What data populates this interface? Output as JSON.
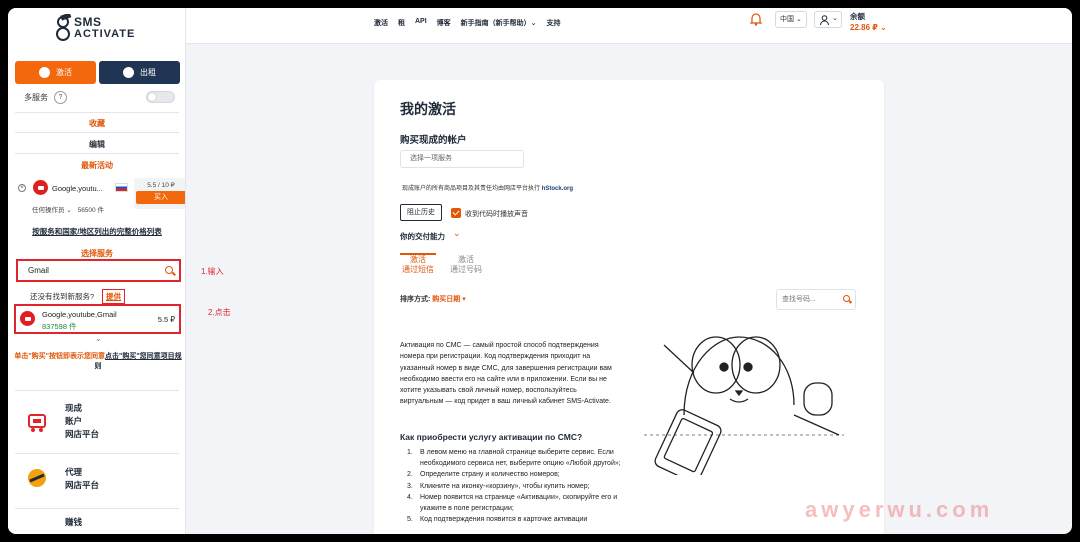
{
  "sidebar": {
    "logo": {
      "line1": "SMS",
      "line2": "ACTIVATE"
    },
    "tabs": {
      "activate": "激活",
      "rent": "出租"
    },
    "multi_service": "多服务",
    "help": "?",
    "favorites": "收藏",
    "edit": "编辑",
    "latest_activity": "最新活动",
    "activity": {
      "close": "×",
      "service": "Google,youtu...",
      "price": "5.5 / 10 ₽",
      "buy": "买入",
      "operator": "任何操作员 ⌄",
      "count": "56500 件"
    },
    "price_list_link": "按服务和国家/地区列出的完整价格列表",
    "select_service": "选择服务",
    "search_value": "Gmail",
    "not_found": "还没有找到新服务?",
    "provide": "提供",
    "service": {
      "name": "Google,youtube,Gmail",
      "count": "837598 件",
      "price": "5.5 ₽"
    },
    "expand": "⌄",
    "notice_orange": "单击\"购买\"按钮即表示您同意",
    "notice_link": "点击\"购买\"您同意项目规",
    "notice_tail": "则",
    "promos": [
      {
        "lines": [
          "现成",
          "账户",
          "网店平台"
        ]
      },
      {
        "lines": [
          "代理",
          "网店平台"
        ]
      },
      {
        "lines": [
          "赚钱"
        ]
      }
    ]
  },
  "topbar": {
    "nav": [
      "激活",
      "租",
      "API",
      "博客",
      "新手指南（新手帮助）⌄",
      "支持"
    ],
    "language": "中国 ⌄",
    "user_chevron": "⌄",
    "balance_label": "余额",
    "balance_value": "22.86 ₽ ⌄"
  },
  "main": {
    "title": "我的激活",
    "buy_account": "购买现成的帐户",
    "select_placeholder": "选择一项服务",
    "stock_note": "现成账户的所有商品项目及其责任均由网店平台执行",
    "stock_brand": "hStock.org",
    "block_history": "阻止历史",
    "sound_label": "收到代码时播放声音",
    "pay_capability": "你的交付能力",
    "pay_chevron": "⌄",
    "tab_sms": [
      "激活",
      "通过短信"
    ],
    "tab_number": [
      "激活",
      "通过号码"
    ],
    "sort_label": "排序方式:",
    "sort_value": "购买日期 ▾",
    "find_placeholder": "查找号码...",
    "description": "Активация по СМС — самый простой способ подтверждения номера при регистрации. Код подтверждения приходит на указанный номер в виде СМС, для завершения регистрации вам необходимо ввести его на сайте или в приложении. Если вы не хотите указывать свой личный номер, воспользуйтесь виртуальным — код придет в ваш личный кабинет SMS-Activate.",
    "how_title": "Как приобрести услугу активации по СМС?",
    "steps": [
      {
        "n": "1.",
        "text": "В левом меню на главной странице выберите сервис. Если необходимого сервиса нет, выберите опцию «Любой другой»;"
      },
      {
        "n": "2.",
        "text": "Определите страну и количество номеров;"
      },
      {
        "n": "3.",
        "text": "Кликните на иконку-«корзину», чтобы купить номер;"
      },
      {
        "n": "4.",
        "text": "Номер появится на странице «Активации», скопируйте его и укажите в поле регистрации;"
      },
      {
        "n": "5.",
        "text": "Код подтверждения появится в карточке активации"
      }
    ]
  },
  "annotations": {
    "input": "1.输入",
    "click": "2.点击"
  },
  "watermark": "awyerwu.com",
  "colors": {
    "accent": "#f3670d",
    "navy": "#1f3553",
    "annotation": "#e0262c",
    "success": "#1a8a3c"
  }
}
